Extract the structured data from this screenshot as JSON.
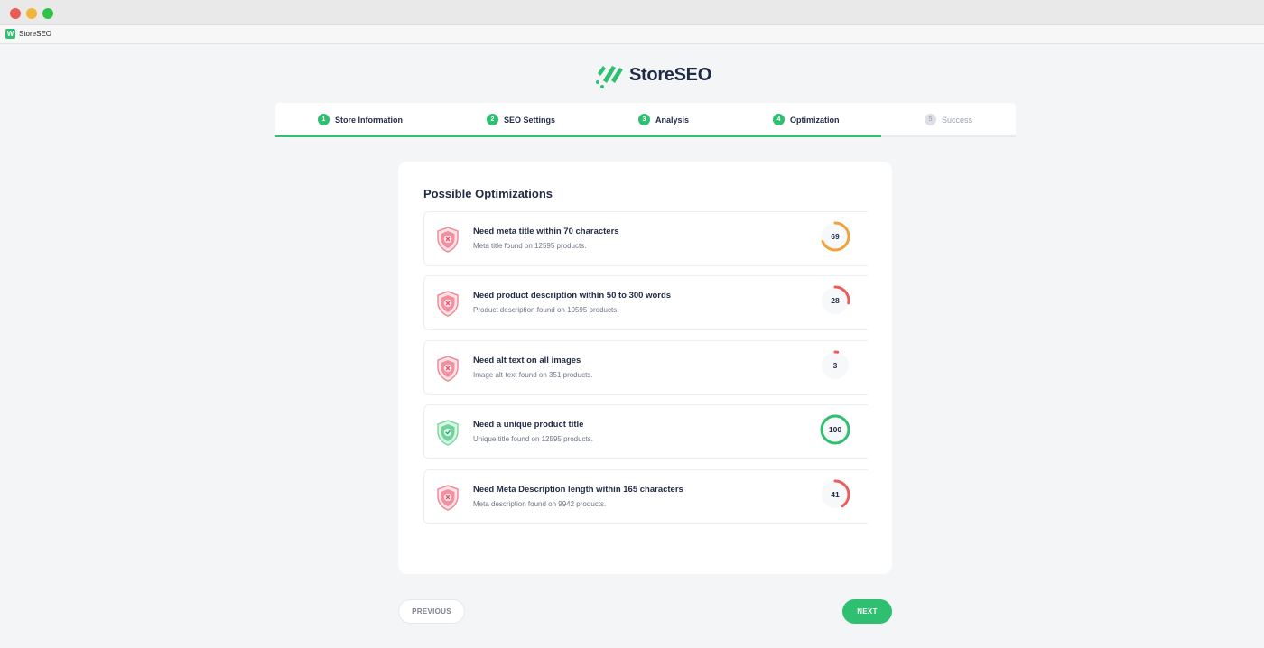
{
  "browser": {
    "tab_title": "StoreSEO",
    "favicon_letter": "W"
  },
  "brand": {
    "name": "StoreSEO",
    "accent_color": "#2fbf71"
  },
  "steps": [
    {
      "number": "1",
      "label": "Store Information",
      "status": "done"
    },
    {
      "number": "2",
      "label": "SEO Settings",
      "status": "done"
    },
    {
      "number": "3",
      "label": "Analysis",
      "status": "done"
    },
    {
      "number": "4",
      "label": "Optimization",
      "status": "active"
    },
    {
      "number": "5",
      "label": "Success",
      "status": "pending"
    }
  ],
  "optimizations": {
    "title": "Possible Optimizations",
    "items": [
      {
        "title": "Need meta title within 70 characters",
        "subtitle": "Meta title found on 12595 products.",
        "score": 69,
        "status": "error",
        "ring_color": "#f0a23b",
        "icon": "shield-x-icon"
      },
      {
        "title": "Need product description within 50 to 300 words",
        "subtitle": "Product description found on 10595 products.",
        "score": 28,
        "status": "error",
        "ring_color": "#ef5b5b",
        "icon": "shield-x-icon"
      },
      {
        "title": "Need alt text on all images",
        "subtitle": "Image alt-text found on 351 products.",
        "score": 3,
        "status": "error",
        "ring_color": "#ef5b5b",
        "icon": "shield-x-icon"
      },
      {
        "title": "Need a unique product title",
        "subtitle": "Unique title found on 12595 products.",
        "score": 100,
        "status": "success",
        "ring_color": "#2fbf71",
        "icon": "shield-check-icon"
      },
      {
        "title": "Need Meta Description length within 165 characters",
        "subtitle": "Meta description found on 9942 products.",
        "score": 41,
        "status": "error",
        "ring_color": "#ef5b5b",
        "icon": "shield-x-icon"
      }
    ]
  },
  "nav": {
    "previous_label": "PREVIOUS",
    "next_label": "NEXT"
  }
}
